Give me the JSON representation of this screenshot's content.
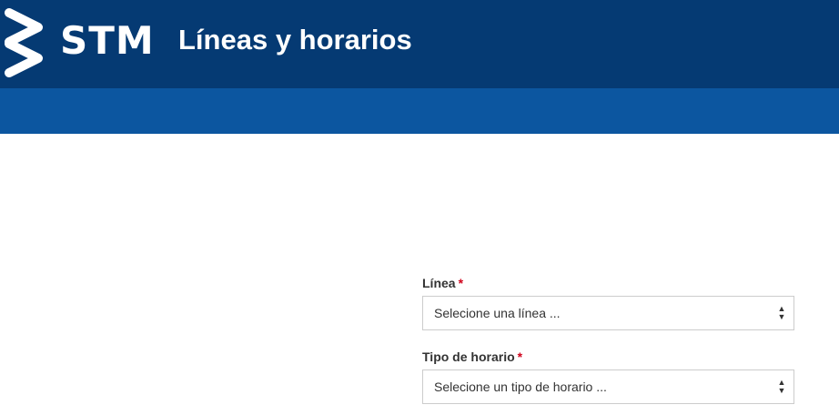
{
  "header": {
    "logo_text": "STM",
    "title": "Líneas y horarios",
    "colors": {
      "top": "#053a73",
      "bar": "#0c56a0"
    }
  },
  "form": {
    "linea": {
      "label": "Línea",
      "required_mark": "*",
      "selected": "Selecione una línea ..."
    },
    "tipo_horario": {
      "label": "Tipo de horario",
      "required_mark": "*",
      "selected": "Selecione un tipo de horario ..."
    },
    "required_color": "#d0021b"
  },
  "icons": {
    "logo": "stm-chevron-logo-icon",
    "select_arrows": "select-updown-arrows-icon"
  }
}
